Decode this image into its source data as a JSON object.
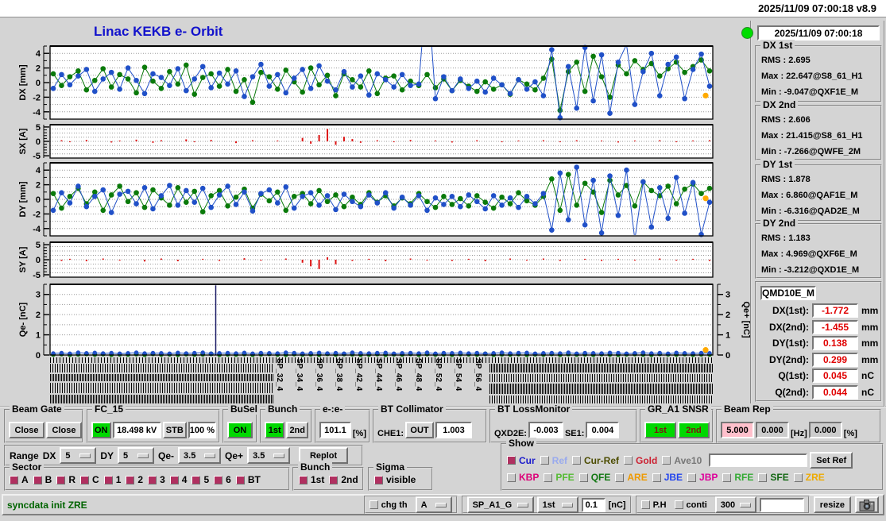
{
  "window": {
    "titlebar_text": "2025/11/09 07:00:18   v8.9"
  },
  "header": {
    "title": "Linac KEKB e- Orbit",
    "timestamp": "2025/11/09 07:00:18",
    "led_color": "#00dd00"
  },
  "colors": {
    "green": "#0a7a0a",
    "blue": "#2050c8",
    "red": "#dd1111",
    "orange": "#ffaa00",
    "accent_blue": "#1212cc",
    "value_red": "#e00000",
    "check_maroon": "#b03060",
    "on_green": "#00d800"
  },
  "stats": [
    {
      "title": "DX 1st",
      "lines": [
        "RMS :  2.695",
        "Max :  22.647@S8_61_H1",
        "Min :  -9.047@QXF1E_M"
      ]
    },
    {
      "title": "DX 2nd",
      "lines": [
        "RMS :  2.606",
        "Max :  21.415@S8_61_H1",
        "Min :  -7.266@QWFE_2M"
      ]
    },
    {
      "title": "DY 1st",
      "lines": [
        "RMS :  1.878",
        "Max :  6.860@QAF1E_M",
        "Min :  -6.316@QAD2E_M"
      ]
    },
    {
      "title": "DY 2nd",
      "lines": [
        "RMS :  1.183",
        "Max :  4.969@QXF6E_M",
        "Min :  -3.212@QXD1E_M"
      ]
    }
  ],
  "monitor": {
    "name": "QMD10E_M",
    "rows": [
      {
        "label": "DX(1st):",
        "value": "-1.772",
        "unit": "mm"
      },
      {
        "label": "DX(2nd):",
        "value": "-1.455",
        "unit": "mm"
      },
      {
        "label": "DY(1st):",
        "value": "0.138",
        "unit": "mm"
      },
      {
        "label": "DY(2nd):",
        "value": "0.299",
        "unit": "mm"
      },
      {
        "label": "Q(1st):",
        "value": "0.045",
        "unit": "nC"
      },
      {
        "label": "Q(2nd):",
        "value": "0.044",
        "unit": "nC"
      }
    ]
  },
  "plots": {
    "dx": {
      "axis_label": "DX [mm]",
      "ticks": [
        4,
        2,
        0,
        -2,
        -4
      ],
      "marker_value": -1.772,
      "green": [
        1.2,
        -0.4,
        0.8,
        1.6,
        -1.0,
        0.3,
        1.9,
        -0.6,
        1.1,
        0.5,
        -1.4,
        2.1,
        0.2,
        -0.8,
        1.5,
        -0.2,
        2.4,
        -1.6,
        0.7,
        1.2,
        -0.5,
        1.8,
        -1.2,
        0.4,
        -2.7,
        1.4,
        0.8,
        -0.9,
        1.7,
        0.1,
        -1.3,
        2.0,
        -0.3,
        1.0,
        -1.8,
        1.2,
        0.4,
        -0.6,
        1.6,
        -1.5,
        0.6,
        0.9,
        -1.0,
        0.2,
        -0.4,
        1.1,
        -0.7,
        0.5,
        -1.1,
        0.3,
        -0.5,
        -1.2,
        0.1,
        -0.9,
        -0.3,
        -1.6,
        0.4,
        -0.2,
        -1.0,
        0.6,
        3.2,
        -3.8,
        1.5,
        2.8,
        -1.2,
        3.6,
        0.8,
        -2.0,
        2.4,
        1.2,
        3.0,
        1.8,
        2.6,
        0.9,
        1.9,
        2.8,
        1.4,
        2.2,
        3.1,
        1.6
      ],
      "blue": [
        -0.8,
        1.1,
        -0.3,
        0.9,
        1.8,
        -1.2,
        0.5,
        1.4,
        -0.9,
        2.0,
        0.3,
        -1.5,
        1.2,
        0.7,
        -0.4,
        1.9,
        -1.1,
        0.5,
        2.2,
        -0.7,
        1.3,
        -0.2,
        1.6,
        -1.9,
        0.8,
        2.5,
        -0.5,
        1.1,
        -1.4,
        0.6,
        1.8,
        -0.8,
        2.3,
        0.2,
        -1.0,
        1.5,
        -0.6,
        0.9,
        -1.7,
        1.2,
        0.4,
        -0.6,
        1.1,
        -0.4,
        -0.2,
        14.0,
        -2.2,
        0.8,
        -1.1,
        0.5,
        -0.8,
        0.2,
        -1.3,
        0.6,
        -0.3,
        -1.5,
        0.4,
        -0.9,
        0.1,
        -1.8,
        4.5,
        -4.8,
        2.2,
        -3.5,
        4.8,
        -2.5,
        3.8,
        -4.2,
        2.8,
        5.2,
        -3.0,
        1.5,
        4.0,
        -1.8,
        2.5,
        3.5,
        -2.2,
        1.8,
        3.9,
        -0.5
      ]
    },
    "sx": {
      "axis_label": "SX [A]",
      "ticks": [
        5,
        0,
        -5
      ],
      "red": [
        0,
        0.4,
        -0.3,
        0,
        0.5,
        0,
        0,
        -0.4,
        0.3,
        0,
        0.6,
        0,
        -0.5,
        0.4,
        0,
        0,
        0.7,
        -0.3,
        0,
        0.5,
        0,
        0,
        -0.6,
        0,
        0.4,
        0,
        0,
        0.3,
        0,
        0,
        1.2,
        -0.8,
        2.2,
        4.3,
        -1.2,
        1.6,
        0.8,
        -0.5,
        0,
        0.4,
        0,
        -0.3,
        0,
        0.5,
        0,
        0,
        0.3,
        0,
        -0.4,
        0,
        0,
        0.4,
        0,
        0,
        -0.3,
        0,
        0.3,
        0,
        0,
        0.4,
        0,
        -0.3,
        0,
        0.4,
        0,
        0,
        0.3,
        0,
        -0.4,
        0,
        0.3,
        0,
        0,
        0.4,
        0,
        -0.3,
        0,
        0.3,
        0,
        0.4
      ]
    },
    "dy": {
      "axis_label": "DY [mm]",
      "ticks": [
        4,
        2,
        0,
        -2,
        -4
      ],
      "marker_value": 0.138,
      "green": [
        0.8,
        -1.2,
        0.4,
        1.5,
        -0.6,
        1.0,
        -1.5,
        0.6,
        1.8,
        -0.3,
        0.9,
        -1.1,
        1.3,
        0.2,
        -0.8,
        1.6,
        -0.4,
        1.1,
        -1.7,
        0.5,
        1.2,
        -0.9,
        0.3,
        1.4,
        -1.2,
        0.7,
        -0.2,
        1.0,
        -1.5,
        0.4,
        0.8,
        -0.6,
        1.2,
        -0.3,
        0.6,
        -1.0,
        0.3,
        -0.7,
        0.9,
        -0.4,
        0.5,
        -0.9,
        0.2,
        -0.6,
        0.8,
        -0.3,
        -1.1,
        0.4,
        -0.7,
        0.1,
        -0.9,
        0.5,
        -0.4,
        -1.2,
        0.3,
        -0.6,
        0.9,
        -0.2,
        -0.8,
        0.4,
        2.8,
        -1.5,
        3.4,
        -0.8,
        2.2,
        1.0,
        -1.8,
        2.6,
        0.6,
        1.9,
        -0.9,
        2.4,
        1.2,
        0.5,
        1.8,
        -0.6,
        1.4,
        2.1,
        0.8,
        1.5
      ],
      "blue": [
        -1.5,
        0.9,
        -0.5,
        1.8,
        -1.0,
        0.4,
        1.3,
        -1.8,
        0.7,
        1.1,
        -0.6,
        1.6,
        -1.3,
        0.5,
        1.9,
        -0.8,
        1.2,
        -0.4,
        1.5,
        -1.1,
        0.6,
        1.8,
        -0.7,
        1.0,
        -1.6,
        0.8,
        1.3,
        -0.5,
        1.7,
        -1.2,
        0.4,
        0.9,
        -0.8,
        0.5,
        -1.4,
        0.7,
        -0.3,
        -1.0,
        0.6,
        -0.5,
        0.9,
        -1.2,
        0.3,
        -0.8,
        0.5,
        -1.5,
        0.2,
        -0.7,
        0.4,
        -1.0,
        0.6,
        -0.3,
        -1.3,
        0.5,
        -0.8,
        0.2,
        -1.1,
        0.4,
        -0.6,
        0.8,
        -4.2,
        3.6,
        -2.8,
        4.4,
        -3.5,
        2.6,
        -4.6,
        3.2,
        -2.2,
        4.0,
        -5.5,
        2.4,
        -3.8,
        1.6,
        -2.6,
        3.0,
        -1.9,
        2.3,
        -4.8,
        -0.4
      ]
    },
    "sy": {
      "axis_label": "SY [A]",
      "ticks": [
        5,
        0,
        -5
      ],
      "red": [
        0,
        -0.4,
        0.3,
        0,
        -0.5,
        0,
        0.4,
        0,
        -0.3,
        0,
        0,
        -0.6,
        0,
        0.4,
        0,
        -0.5,
        0,
        0,
        0.3,
        0,
        -0.4,
        0,
        0,
        0.5,
        0,
        -0.3,
        0,
        0,
        0.4,
        0,
        -1.0,
        -2.2,
        -3.1,
        0.8,
        -1.5,
        0,
        -0.4,
        0,
        0.3,
        0,
        -0.5,
        0,
        0,
        0.4,
        0,
        -0.3,
        0,
        0,
        -0.4,
        0,
        0.3,
        0,
        -0.5,
        0,
        0,
        0.4,
        0,
        -0.3,
        0,
        0.4,
        0,
        -0.4,
        0,
        0,
        0.3,
        0,
        -0.4,
        0,
        0.3,
        0,
        -0.3,
        0,
        0,
        0.4,
        0,
        -0.3,
        0,
        0.3,
        0,
        -0.4
      ]
    },
    "q": {
      "axis_label": "Qe- [nC]",
      "axis_label_right": "Qe+ [nC]",
      "ticks": [
        3,
        2,
        1,
        0
      ],
      "spike_x_pct": 25,
      "marker_value": 0.25,
      "blue": [
        0.08,
        0.1,
        0.07,
        0.12,
        0.09,
        0.11,
        0.08,
        0.1,
        0.07,
        0.09,
        0.12,
        0.08,
        0.1,
        0.09,
        0.07,
        0.11,
        0.08,
        0.1,
        0.12,
        0.07,
        0.09,
        0.1,
        0.08,
        0.11,
        0.07,
        0.1,
        0.09,
        0.08,
        0.12,
        0.1,
        0.07,
        0.09,
        0.11,
        0.08,
        0.1,
        0.07,
        0.12,
        0.09,
        0.08,
        0.1,
        0.11,
        0.07,
        0.09,
        0.1,
        0.08,
        0.12,
        0.07,
        0.1,
        0.09,
        0.11,
        0.08,
        0.1,
        0.07,
        0.09,
        0.12,
        0.08,
        0.1,
        0.11,
        0.07,
        0.09,
        0.1,
        0.08,
        0.12,
        0.07,
        0.1,
        0.09,
        0.08,
        0.11,
        0.1,
        0.07,
        0.09,
        0.12,
        0.08,
        0.1,
        0.07,
        0.11,
        0.09,
        0.08,
        0.1,
        0.09
      ],
      "green": [
        0.03,
        0.05,
        0.02,
        0.04,
        0.06,
        0.03,
        0.05,
        0.02,
        0.04,
        0.03,
        0.05,
        0.02,
        0.06,
        0.03,
        0.04,
        0.02,
        0.05,
        0.03,
        0.04,
        0.06,
        0.02,
        0.04,
        0.03,
        0.05,
        0.02,
        0.04,
        0.06,
        0.03,
        0.02,
        0.05,
        0.03,
        0.04,
        0.02,
        0.06,
        0.03,
        0.05,
        0.04,
        0.02,
        0.03,
        0.05,
        0.02,
        0.04,
        0.03,
        0.06,
        0.02,
        0.05,
        0.03,
        0.04,
        0.02,
        0.05,
        0.04,
        0.03,
        0.06,
        0.02,
        0.04,
        0.03,
        0.05,
        0.02,
        0.04,
        0.03,
        0.06,
        0.02,
        0.05,
        0.03,
        0.04,
        0.02,
        0.05,
        0.03,
        0.02,
        0.04,
        0.05,
        0.03,
        0.02,
        0.06,
        0.04,
        0.03,
        0.05,
        0.02,
        0.04,
        0.03
      ]
    }
  },
  "xaxis": {
    "labels": [
      "SP_32_4",
      "SP_34_4",
      "SP_36_4",
      "SP_38_4",
      "SP_42_4",
      "SP_44_4",
      "SP_46_4",
      "SP_48_4",
      "SP_52_4",
      "SP_54_4",
      "SP_56_4"
    ]
  },
  "controls": {
    "beam_gate": {
      "title": "Beam Gate",
      "buttons": [
        "Close",
        "Close"
      ]
    },
    "fc15": {
      "title": "FC_15",
      "on": "ON",
      "kv": "18.498 kV",
      "stb": "STB",
      "pct": "100 %"
    },
    "busel": {
      "title": "BuSel",
      "on": "ON"
    },
    "bunch": {
      "title": "Bunch",
      "b1": "1st",
      "b2": "2nd"
    },
    "ee": {
      "title": "e-:e-",
      "value": "101.1",
      "unit": "[%]"
    },
    "bt_collimator": {
      "title": "BT Collimator",
      "label": "CHE1:",
      "button": "OUT",
      "value": "1.003"
    },
    "bt_lossmonitor": {
      "title": "BT LossMonitor",
      "l1": "QXD2E:",
      "v1": "-0.003",
      "l2": "SE1:",
      "v2": "0.004"
    },
    "gr_a1": {
      "title": "GR_A1 SNSR",
      "b1": "1st",
      "b2": "2nd"
    },
    "beam_rep": {
      "title": "Beam Rep",
      "v1": "5.000",
      "v2": "0.000",
      "u1": "[Hz]",
      "v3": "0.000",
      "u2": "[%]"
    }
  },
  "range_row": {
    "label": "Range",
    "dx_label": "DX",
    "dx": "5",
    "dy_label": "DY",
    "dy": "5",
    "qem_label": "Qe-",
    "qem": "3.5",
    "qep_label": "Qe+",
    "qep": "3.5",
    "replot": "Replot"
  },
  "sector": {
    "title": "Sector",
    "items": [
      {
        "label": "A",
        "checked": true
      },
      {
        "label": "B",
        "checked": true
      },
      {
        "label": "R",
        "checked": true
      },
      {
        "label": "C",
        "checked": true
      },
      {
        "label": "1",
        "checked": true
      },
      {
        "label": "2",
        "checked": true
      },
      {
        "label": "3",
        "checked": true
      },
      {
        "label": "4",
        "checked": true
      },
      {
        "label": "5",
        "checked": true
      },
      {
        "label": "6",
        "checked": true
      },
      {
        "label": "BT",
        "checked": true
      }
    ]
  },
  "bunch2": {
    "title": "Bunch",
    "items": [
      {
        "label": "1st",
        "checked": true
      },
      {
        "label": "2nd",
        "checked": true
      }
    ]
  },
  "sigma": {
    "title": "Sigma",
    "items": [
      {
        "label": "visible",
        "checked": true
      }
    ]
  },
  "show": {
    "title": "Show",
    "set_ref": "Set Ref",
    "input_value": "",
    "row1": [
      {
        "label": "Cur",
        "color": "#1a1acc",
        "checked": true
      },
      {
        "label": "Ref",
        "color": "#99aaee",
        "checked": false
      },
      {
        "label": "Cur-Ref",
        "color": "#4c4c00",
        "checked": false
      },
      {
        "label": "Gold",
        "color": "#cc2233",
        "checked": false
      },
      {
        "label": "Ave10",
        "color": "#777777",
        "checked": false
      }
    ],
    "row2": [
      {
        "label": "KBP",
        "color": "#dd0077",
        "checked": false
      },
      {
        "label": "PFE",
        "color": "#55bb33",
        "checked": false
      },
      {
        "label": "QFE",
        "color": "#117711",
        "checked": false
      },
      {
        "label": "ARE",
        "color": "#ee9900",
        "checked": false
      },
      {
        "label": "JBE",
        "color": "#2244ee",
        "checked": false
      },
      {
        "label": "JBP",
        "color": "#dd0099",
        "checked": false
      },
      {
        "label": "RFE",
        "color": "#33aa33",
        "checked": false
      },
      {
        "label": "SFE",
        "color": "#116611",
        "checked": false
      },
      {
        "label": "ZRE",
        "color": "#eeaa00",
        "checked": false
      }
    ]
  },
  "statusbar": {
    "message": "syncdata init ZRE",
    "chg_th": "chg th",
    "dd1": "A",
    "dd2": "SP_A1_G",
    "dd3": "1st",
    "threshold": "0.1",
    "unit": "[nC]",
    "ph": "P.H",
    "conti": "conti",
    "dd4": "300",
    "input2": "",
    "resize": "resize"
  }
}
